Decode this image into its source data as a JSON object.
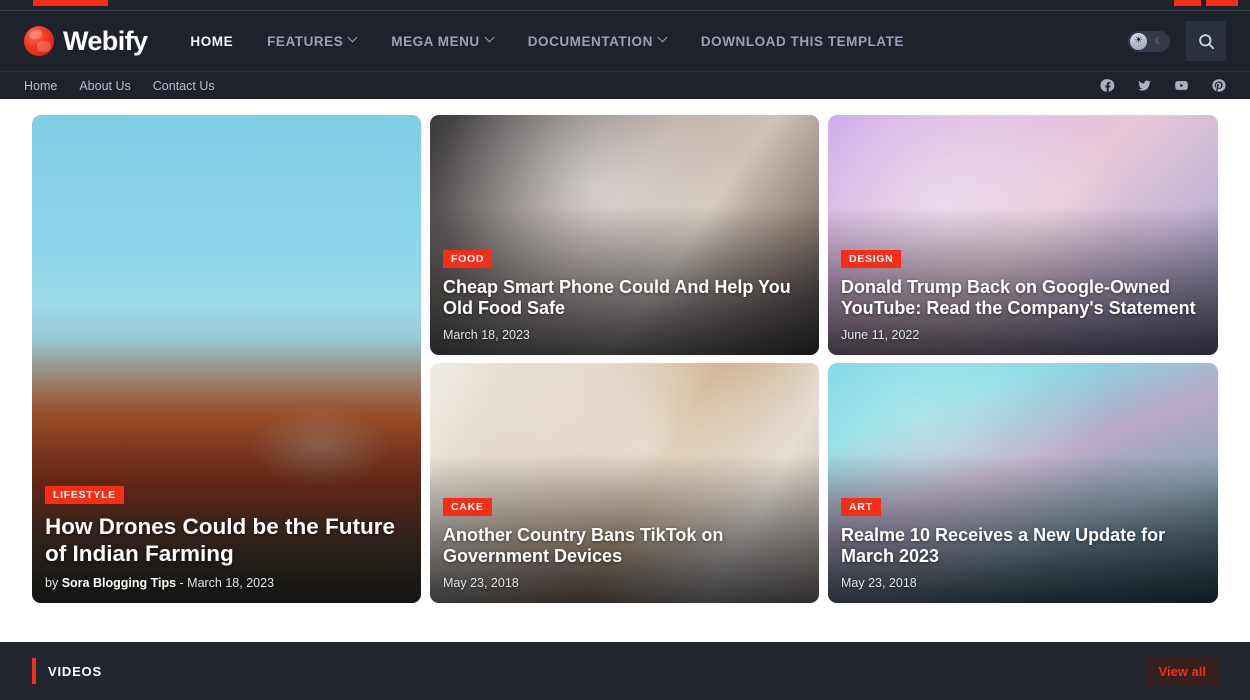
{
  "brand": {
    "name": "Webify",
    "logo_icon": "globe-icon"
  },
  "topbar": {
    "accent_color": "#f62d17"
  },
  "nav": {
    "items": [
      {
        "label": "HOME",
        "has_dropdown": false,
        "active": true
      },
      {
        "label": "FEATURES",
        "has_dropdown": true,
        "active": false
      },
      {
        "label": "MEGA MENU",
        "has_dropdown": true,
        "active": false
      },
      {
        "label": "DOCUMENTATION",
        "has_dropdown": true,
        "active": false
      },
      {
        "label": "DOWNLOAD THIS TEMPLATE",
        "has_dropdown": false,
        "active": false
      }
    ],
    "theme_toggle_icon": "sun-moon-toggle-icon",
    "search_icon": "search-icon"
  },
  "subnav": {
    "links": [
      {
        "label": "Home"
      },
      {
        "label": "About Us"
      },
      {
        "label": "Contact Us"
      }
    ],
    "social": [
      {
        "name": "facebook-icon"
      },
      {
        "name": "twitter-icon"
      },
      {
        "name": "youtube-icon"
      },
      {
        "name": "pinterest-icon"
      }
    ]
  },
  "featured": {
    "cards": [
      {
        "category": "LIFESTYLE",
        "title": "How Drones Could be the Future of Indian Farming",
        "meta_prefix": "by ",
        "author": "Sora Blogging Tips",
        "meta_sep": " - ",
        "date": "March 18, 2023"
      },
      {
        "category": "FOOD",
        "title": "Cheap Smart Phone Could And Help You Old Food Safe",
        "date": "March 18, 2023"
      },
      {
        "category": "DESIGN",
        "title": "Donald Trump Back on Google-Owned YouTube: Read the Company's Statement",
        "date": "June 11, 2022"
      },
      {
        "category": "CAKE",
        "title": "Another Country Bans TikTok on Government Devices",
        "date": "May 23, 2018"
      },
      {
        "category": "ART",
        "title": "Realme 10 Receives a New Update for March 2023",
        "date": "May 23, 2018"
      }
    ]
  },
  "videos_section": {
    "title": "VIDEOS",
    "view_all_label": "View all",
    "accent_color": "#f62d17"
  }
}
